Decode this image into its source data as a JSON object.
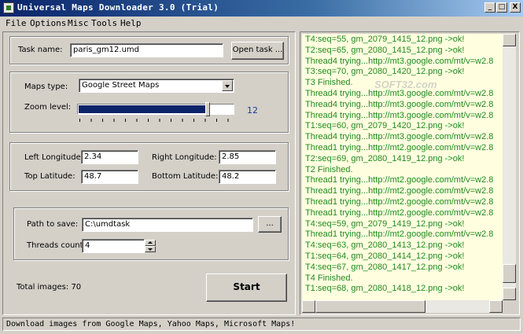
{
  "window": {
    "title": "Universal Maps Downloader 3.0 (Trial)",
    "minimize": "_",
    "maximize": "□",
    "close": "X"
  },
  "menu": [
    "File",
    "Options",
    "Misc",
    "Tools",
    "Help"
  ],
  "task": {
    "label": "Task name:",
    "value": "paris_gm12.umd",
    "open_button": "Open task ..."
  },
  "maps": {
    "type_label": "Maps type:",
    "type_value": "Google Street Maps",
    "zoom_label": "Zoom level:",
    "zoom_value": "12",
    "zoom_fraction": 0.83
  },
  "coords": {
    "left_lon_label": "Left Longitude:",
    "left_lon": "2.34",
    "right_lon_label": "Right Longitude:",
    "right_lon": "2.85",
    "top_lat_label": "Top Latitude:",
    "top_lat": "48.7",
    "bottom_lat_label": "Bottom Latitude:",
    "bottom_lat": "48.2"
  },
  "save": {
    "path_label": "Path to save:",
    "path_value": "C:\\umdtask",
    "browse_button": "...",
    "threads_label": "Threads count:",
    "threads_value": "4"
  },
  "total_images": "Total images: 70",
  "start_button": "Start",
  "log": [
    "T4:seq=55, gm_2079_1415_12.png ->ok!",
    "T2:seq=65, gm_2080_1415_12.png ->ok!",
    "Thread4 trying...http://mt3.google.com/mt/v=w2.8",
    "T3:seq=70, gm_2080_1420_12.png ->ok!",
    "T3 Finished.",
    "Thread4 trying...http://mt3.google.com/mt/v=w2.8",
    "Thread4 trying...http://mt3.google.com/mt/v=w2.8",
    "Thread4 trying...http://mt3.google.com/mt/v=w2.8",
    "T1:seq=60, gm_2079_1420_12.png ->ok!",
    "Thread4 trying...http://mt3.google.com/mt/v=w2.8",
    "Thread1 trying...http://mt2.google.com/mt/v=w2.8",
    "T2:seq=69, gm_2080_1419_12.png ->ok!",
    "T2 Finished.",
    "Thread1 trying...http://mt2.google.com/mt/v=w2.8",
    "Thread1 trying...http://mt2.google.com/mt/v=w2.8",
    "Thread1 trying...http://mt2.google.com/mt/v=w2.8",
    "Thread1 trying...http://mt2.google.com/mt/v=w2.8",
    "T4:seq=59, gm_2079_1419_12.png ->ok!",
    "Thread1 trying...http://mt2.google.com/mt/v=w2.8",
    "T4:seq=63, gm_2080_1413_12.png ->ok!",
    "T1:seq=64, gm_2080_1414_12.png ->ok!",
    "T4:seq=67, gm_2080_1417_12.png ->ok!",
    "T4 Finished.",
    "T1:seq=68, gm_2080_1418_12.png ->ok!"
  ],
  "watermark": "SOFT32.com",
  "status": "Download images from Google Maps, Yahoo Maps, Microsoft Maps!",
  "colors": {
    "titlebar": "#0a246a",
    "log_bg": "#ffffe0",
    "log_text": "#1f8a1f",
    "zoom_value": "#1a3a9a"
  }
}
